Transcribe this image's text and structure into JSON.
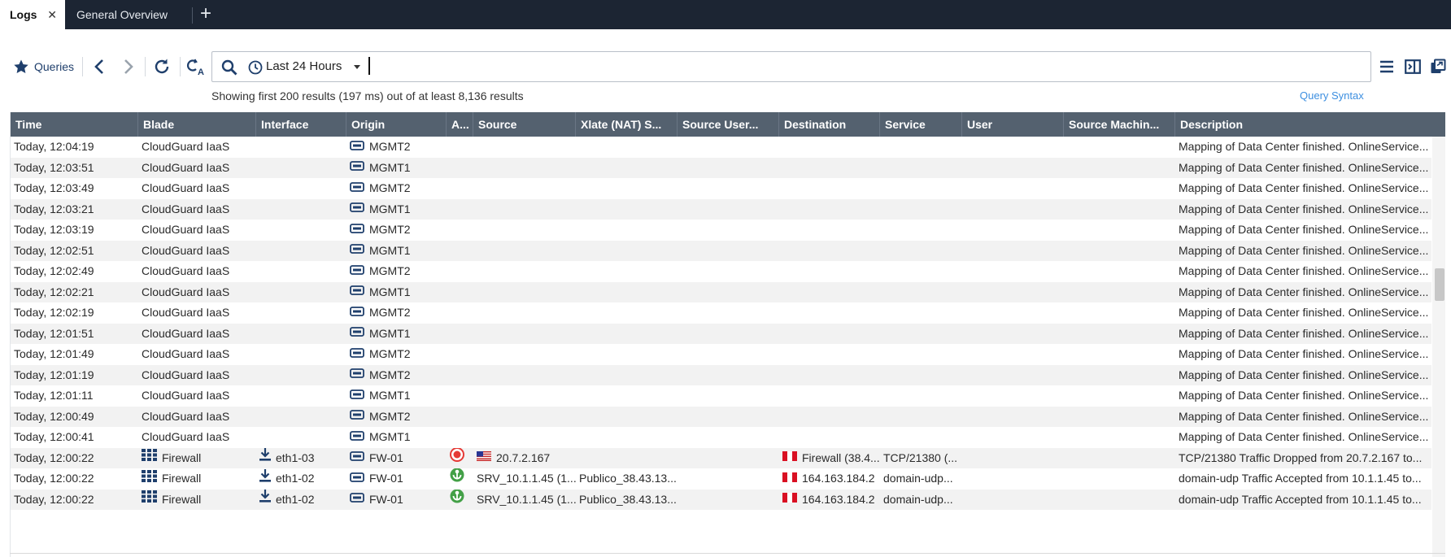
{
  "tabs": [
    {
      "label": "Logs",
      "active": true
    },
    {
      "label": "General Overview",
      "active": false
    }
  ],
  "toolbar": {
    "queries_label": "Queries",
    "time_range": "Last 24 Hours",
    "search_value": "",
    "summary": "Showing first 200 results (197 ms) out of at least 8,136 results",
    "query_syntax_label": "Query Syntax"
  },
  "columns": [
    "Time",
    "Blade",
    "Interface",
    "Origin",
    "A...",
    "Source",
    "Xlate (NAT) S...",
    "Source User...",
    "Destination",
    "Service",
    "User",
    "Source Machin...",
    "Description"
  ],
  "rows": [
    {
      "time": "Today, 12:04:19",
      "blade": "CloudGuard IaaS",
      "blade_icon": "",
      "interface": "",
      "origin": "MGMT2",
      "action": "",
      "source": "",
      "xlate": "",
      "source_user": "",
      "destination": "",
      "service": "",
      "user": "",
      "source_machine": "",
      "description": "Mapping of Data Center finished. OnlineService..."
    },
    {
      "time": "Today, 12:03:51",
      "blade": "CloudGuard IaaS",
      "blade_icon": "",
      "interface": "",
      "origin": "MGMT1",
      "action": "",
      "source": "",
      "xlate": "",
      "source_user": "",
      "destination": "",
      "service": "",
      "user": "",
      "source_machine": "",
      "description": "Mapping of Data Center finished. OnlineService..."
    },
    {
      "time": "Today, 12:03:49",
      "blade": "CloudGuard IaaS",
      "blade_icon": "",
      "interface": "",
      "origin": "MGMT2",
      "action": "",
      "source": "",
      "xlate": "",
      "source_user": "",
      "destination": "",
      "service": "",
      "user": "",
      "source_machine": "",
      "description": "Mapping of Data Center finished. OnlineService..."
    },
    {
      "time": "Today, 12:03:21",
      "blade": "CloudGuard IaaS",
      "blade_icon": "",
      "interface": "",
      "origin": "MGMT1",
      "action": "",
      "source": "",
      "xlate": "",
      "source_user": "",
      "destination": "",
      "service": "",
      "user": "",
      "source_machine": "",
      "description": "Mapping of Data Center finished. OnlineService..."
    },
    {
      "time": "Today, 12:03:19",
      "blade": "CloudGuard IaaS",
      "blade_icon": "",
      "interface": "",
      "origin": "MGMT2",
      "action": "",
      "source": "",
      "xlate": "",
      "source_user": "",
      "destination": "",
      "service": "",
      "user": "",
      "source_machine": "",
      "description": "Mapping of Data Center finished. OnlineService..."
    },
    {
      "time": "Today, 12:02:51",
      "blade": "CloudGuard IaaS",
      "blade_icon": "",
      "interface": "",
      "origin": "MGMT1",
      "action": "",
      "source": "",
      "xlate": "",
      "source_user": "",
      "destination": "",
      "service": "",
      "user": "",
      "source_machine": "",
      "description": "Mapping of Data Center finished. OnlineService..."
    },
    {
      "time": "Today, 12:02:49",
      "blade": "CloudGuard IaaS",
      "blade_icon": "",
      "interface": "",
      "origin": "MGMT2",
      "action": "",
      "source": "",
      "xlate": "",
      "source_user": "",
      "destination": "",
      "service": "",
      "user": "",
      "source_machine": "",
      "description": "Mapping of Data Center finished. OnlineService..."
    },
    {
      "time": "Today, 12:02:21",
      "blade": "CloudGuard IaaS",
      "blade_icon": "",
      "interface": "",
      "origin": "MGMT1",
      "action": "",
      "source": "",
      "xlate": "",
      "source_user": "",
      "destination": "",
      "service": "",
      "user": "",
      "source_machine": "",
      "description": "Mapping of Data Center finished. OnlineService..."
    },
    {
      "time": "Today, 12:02:19",
      "blade": "CloudGuard IaaS",
      "blade_icon": "",
      "interface": "",
      "origin": "MGMT2",
      "action": "",
      "source": "",
      "xlate": "",
      "source_user": "",
      "destination": "",
      "service": "",
      "user": "",
      "source_machine": "",
      "description": "Mapping of Data Center finished. OnlineService..."
    },
    {
      "time": "Today, 12:01:51",
      "blade": "CloudGuard IaaS",
      "blade_icon": "",
      "interface": "",
      "origin": "MGMT1",
      "action": "",
      "source": "",
      "xlate": "",
      "source_user": "",
      "destination": "",
      "service": "",
      "user": "",
      "source_machine": "",
      "description": "Mapping of Data Center finished. OnlineService..."
    },
    {
      "time": "Today, 12:01:49",
      "blade": "CloudGuard IaaS",
      "blade_icon": "",
      "interface": "",
      "origin": "MGMT2",
      "action": "",
      "source": "",
      "xlate": "",
      "source_user": "",
      "destination": "",
      "service": "",
      "user": "",
      "source_machine": "",
      "description": "Mapping of Data Center finished. OnlineService..."
    },
    {
      "time": "Today, 12:01:19",
      "blade": "CloudGuard IaaS",
      "blade_icon": "",
      "interface": "",
      "origin": "MGMT2",
      "action": "",
      "source": "",
      "xlate": "",
      "source_user": "",
      "destination": "",
      "service": "",
      "user": "",
      "source_machine": "",
      "description": "Mapping of Data Center finished. OnlineService..."
    },
    {
      "time": "Today, 12:01:11",
      "blade": "CloudGuard IaaS",
      "blade_icon": "",
      "interface": "",
      "origin": "MGMT1",
      "action": "",
      "source": "",
      "xlate": "",
      "source_user": "",
      "destination": "",
      "service": "",
      "user": "",
      "source_machine": "",
      "description": "Mapping of Data Center finished. OnlineService..."
    },
    {
      "time": "Today, 12:00:49",
      "blade": "CloudGuard IaaS",
      "blade_icon": "",
      "interface": "",
      "origin": "MGMT2",
      "action": "",
      "source": "",
      "xlate": "",
      "source_user": "",
      "destination": "",
      "service": "",
      "user": "",
      "source_machine": "",
      "description": "Mapping of Data Center finished. OnlineService..."
    },
    {
      "time": "Today, 12:00:41",
      "blade": "CloudGuard IaaS",
      "blade_icon": "",
      "interface": "",
      "origin": "MGMT1",
      "action": "",
      "source": "",
      "xlate": "",
      "source_user": "",
      "destination": "",
      "service": "",
      "user": "",
      "source_machine": "",
      "description": "Mapping of Data Center finished. OnlineService..."
    },
    {
      "time": "Today, 12:00:22",
      "blade": "Firewall",
      "blade_icon": "firewall-icon",
      "interface": "eth1-03",
      "origin": "FW-01",
      "action": "drop",
      "source_flag": "us-flag-icon",
      "source": "20.7.2.167",
      "xlate": "",
      "source_user": "",
      "dest_flag": "peru-flag-icon",
      "destination": "Firewall (38.4...",
      "service": "TCP/21380 (...",
      "user": "",
      "source_machine": "",
      "description": "TCP/21380 Traffic Dropped from 20.7.2.167 to..."
    },
    {
      "time": "Today, 12:00:22",
      "blade": "Firewall",
      "blade_icon": "firewall-icon",
      "interface": "eth1-02",
      "origin": "FW-01",
      "action": "accept",
      "source_flag": "",
      "source": "SRV_10.1.1.45 (1...",
      "xlate": "Publico_38.43.13...",
      "source_user": "",
      "dest_flag": "peru-flag-icon",
      "destination": "164.163.184.2",
      "service": "domain-udp...",
      "user": "",
      "source_machine": "",
      "description": "domain-udp Traffic Accepted from 10.1.1.45 to..."
    },
    {
      "time": "Today, 12:00:22",
      "blade": "Firewall",
      "blade_icon": "firewall-icon",
      "interface": "eth1-02",
      "origin": "FW-01",
      "action": "accept",
      "source_flag": "",
      "source": "SRV_10.1.1.45 (1...",
      "xlate": "Publico_38.43.13...",
      "source_user": "",
      "dest_flag": "peru-flag-icon",
      "destination": "164.163.184.2",
      "service": "domain-udp...",
      "user": "",
      "source_machine": "",
      "description": "domain-udp Traffic Accepted from 10.1.1.45 to..."
    }
  ],
  "colors": {
    "tabbar_bg": "#1c2533",
    "header_bg": "#54616f",
    "accent_link": "#3d8fe0",
    "icon_blue": "#1f3f6c",
    "drop_red": "#e53935",
    "accept_green": "#43a047"
  }
}
